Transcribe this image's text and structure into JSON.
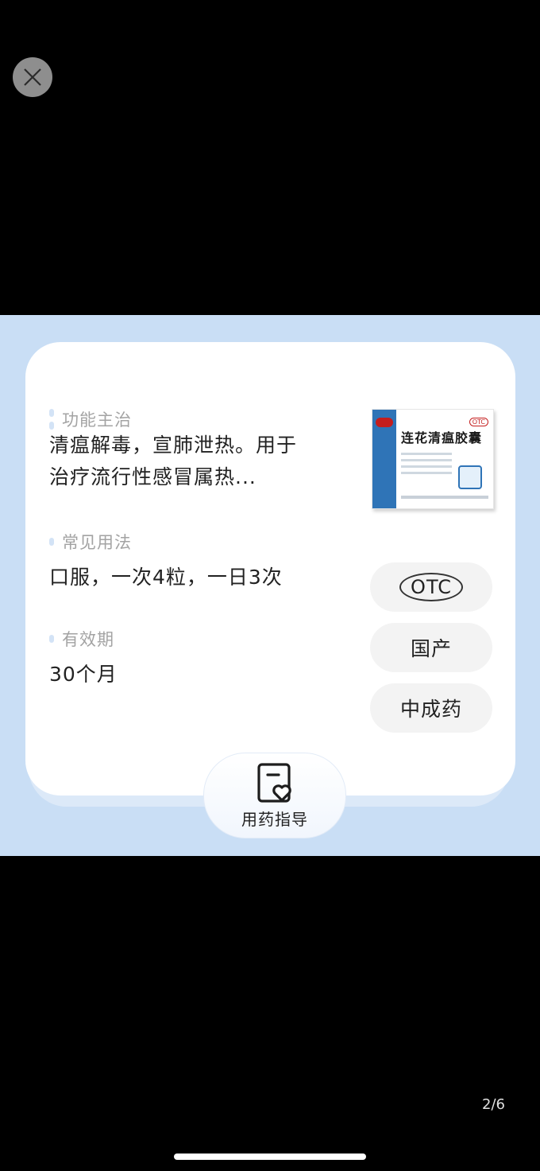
{
  "viewer": {
    "close_icon": "close-icon",
    "page_indicator": "2/6"
  },
  "card": {
    "sections": [
      {
        "label": "功能主治",
        "value": "清瘟解毒，宣肺泄热。用于治疗流行性感冒属热..."
      },
      {
        "label": "常见用法",
        "value": "口服，一次4粒，一日3次"
      },
      {
        "label": "有效期",
        "value": "30个月"
      }
    ],
    "product_box": {
      "name": "连花清瘟胶囊",
      "badge": "OTC"
    },
    "tags": [
      "OTC",
      "国产",
      "中成药"
    ],
    "guide_button": {
      "label": "用药指导",
      "icon": "document-heart-icon"
    }
  },
  "colors": {
    "frame_background": "#c9def5",
    "card_background": "#ffffff",
    "tag_background": "#f3f3f3",
    "label_color": "#a3a3a3",
    "dot_color": "#d3e3f6"
  }
}
